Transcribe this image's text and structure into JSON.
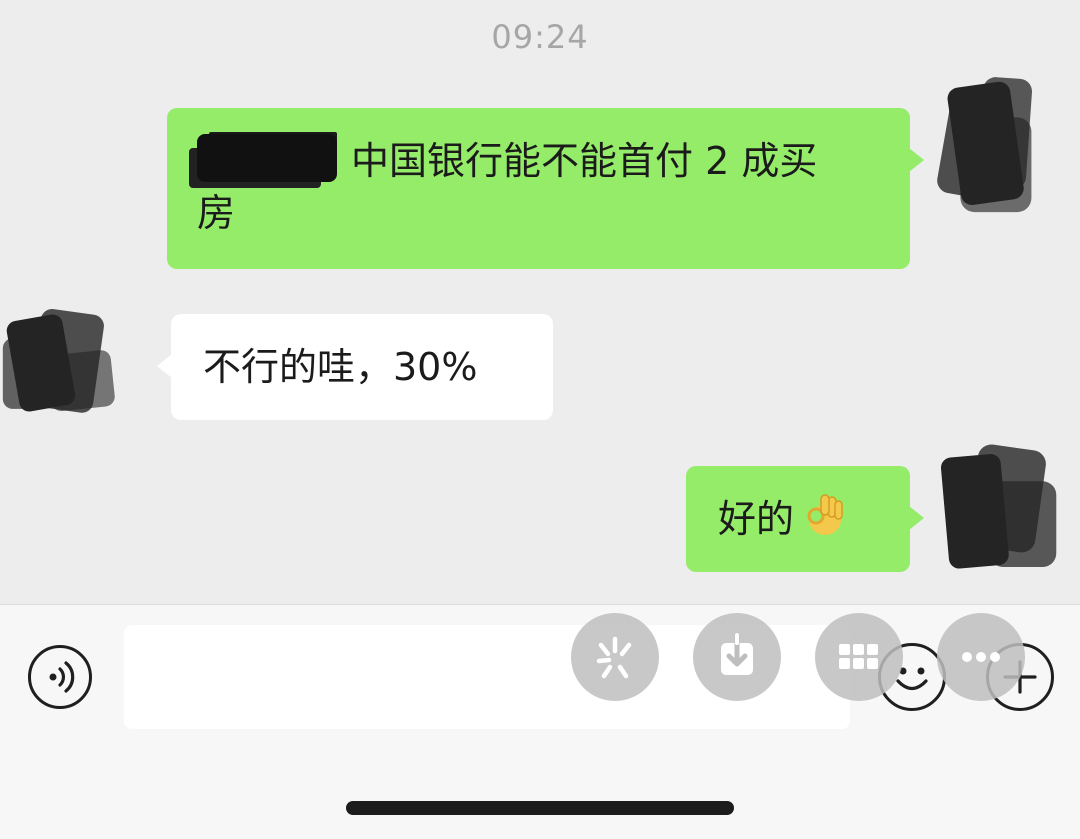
{
  "chat": {
    "timestamp": "09:24",
    "messages": [
      {
        "sender": "me",
        "text": "中国银行能不能首付 2 成买",
        "text_line2": "房",
        "redacted_prefix": true
      },
      {
        "sender": "them",
        "text": "不行的哇，30%"
      },
      {
        "sender": "me",
        "text": "好的",
        "emoji": "ok-hand"
      }
    ]
  },
  "input_bar": {
    "value": "",
    "icons": [
      "voice-icon",
      "emoji-icon",
      "plus-icon"
    ]
  },
  "floating_actions": [
    "sparkle-action",
    "download-action",
    "grid-action",
    "more-action"
  ],
  "colors": {
    "my_bubble": "#95ec69",
    "their_bubble": "#ffffff",
    "background": "#ededed",
    "timestamp_text": "#a6a6a6"
  }
}
